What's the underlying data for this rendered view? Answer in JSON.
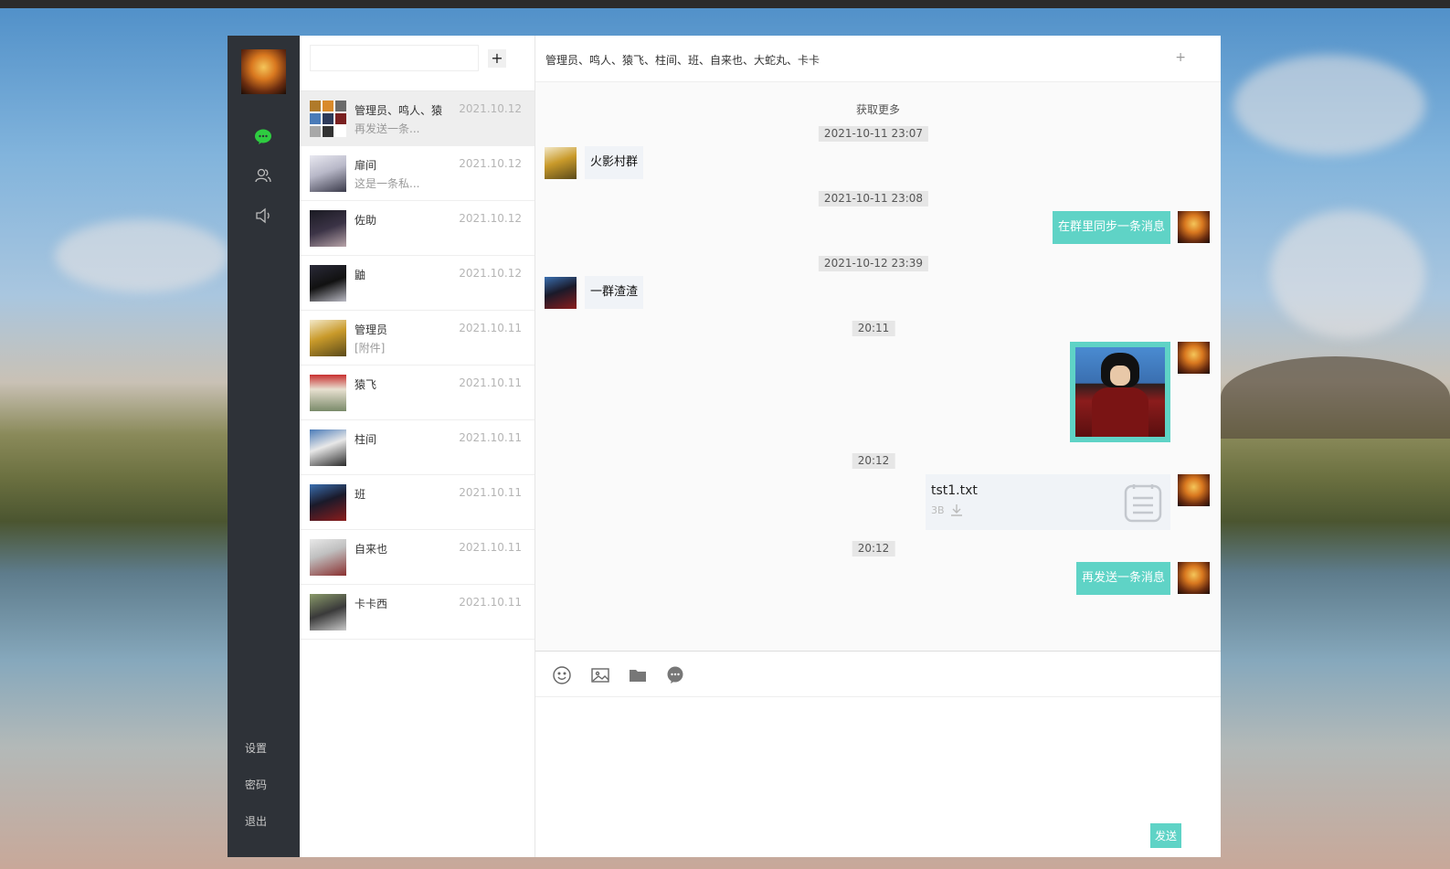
{
  "theme": {
    "accent": "#5fd3c6",
    "sidebar": "#2e3238",
    "online": "#2ecc40"
  },
  "sidebar": {
    "nav": [
      {
        "icon": "chat-icon",
        "active": true
      },
      {
        "icon": "contacts-icon",
        "active": false
      },
      {
        "icon": "announcement-icon",
        "active": false
      }
    ],
    "links": {
      "settings": "设置",
      "password": "密码",
      "logout": "退出"
    }
  },
  "search": {
    "value": "",
    "placeholder": "",
    "add_label": "+"
  },
  "sessions": [
    {
      "name": "管理员、鸣人、猿",
      "preview": "再发送一条...",
      "date": "2021.10.12"
    },
    {
      "name": "扉间",
      "preview": "这是一条私...",
      "date": "2021.10.12"
    },
    {
      "name": "佐助",
      "preview": "",
      "date": "2021.10.12"
    },
    {
      "name": "鼬",
      "preview": "",
      "date": "2021.10.12"
    },
    {
      "name": "管理员",
      "preview": "[附件]",
      "date": "2021.10.11"
    },
    {
      "name": "猿飞",
      "preview": "",
      "date": "2021.10.11"
    },
    {
      "name": "柱间",
      "preview": "",
      "date": "2021.10.11"
    },
    {
      "name": "班",
      "preview": "",
      "date": "2021.10.11"
    },
    {
      "name": "自来也",
      "preview": "",
      "date": "2021.10.11"
    },
    {
      "name": "卡卡西",
      "preview": "",
      "date": "2021.10.11"
    }
  ],
  "chat": {
    "title": "管理员、鸣人、猿飞、柱间、班、自来也、大蛇丸、卡卡",
    "more_label": "+",
    "load_more": "获取更多",
    "messages": {
      "t1": "2021-10-11 23:07",
      "m1": "火影村群",
      "t2": "2021-10-11 23:08",
      "m2": "在群里同步一条消息",
      "t3": "2021-10-12 23:39",
      "m3": "一群渣渣",
      "t4": "20:11",
      "t5": "20:12",
      "file_name": "tst1.txt",
      "file_size": "3B",
      "t6": "20:12",
      "m6": "再发送一条消息"
    },
    "toolbar": [
      "emoji-icon",
      "image-icon",
      "folder-icon",
      "quick-reply-icon"
    ],
    "editor_value": "",
    "send_label": "发送"
  }
}
